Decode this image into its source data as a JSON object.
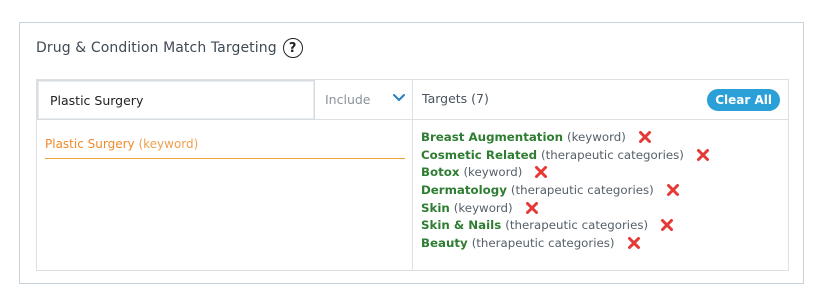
{
  "panel": {
    "title": "Drug & Condition Match Targeting",
    "help_icon": "question-circle-icon"
  },
  "search": {
    "value": "Plastic Surgery",
    "mode": "Include",
    "mode_icon": "chevron-down-icon"
  },
  "suggestion": {
    "name": "Plastic Surgery",
    "type": "(keyword)"
  },
  "targets": {
    "label": "Targets (7)",
    "clear_all": "Clear All",
    "remove_icon": "red-x-icon",
    "items": [
      {
        "name": "Breast Augmentation",
        "type": "(keyword)"
      },
      {
        "name": "Cosmetic Related",
        "type": "(therapeutic categories)"
      },
      {
        "name": "Botox",
        "type": "(keyword)"
      },
      {
        "name": "Dermatology",
        "type": "(therapeutic categories)"
      },
      {
        "name": "Skin",
        "type": "(keyword)"
      },
      {
        "name": "Skin & Nails",
        "type": "(therapeutic categories)"
      },
      {
        "name": "Beauty",
        "type": "(therapeutic categories)"
      }
    ]
  },
  "colors": {
    "accent": "#2a9fd8",
    "target_name": "#2e7d32",
    "suggestion": "#f08a2a",
    "remove": "#e53935"
  }
}
